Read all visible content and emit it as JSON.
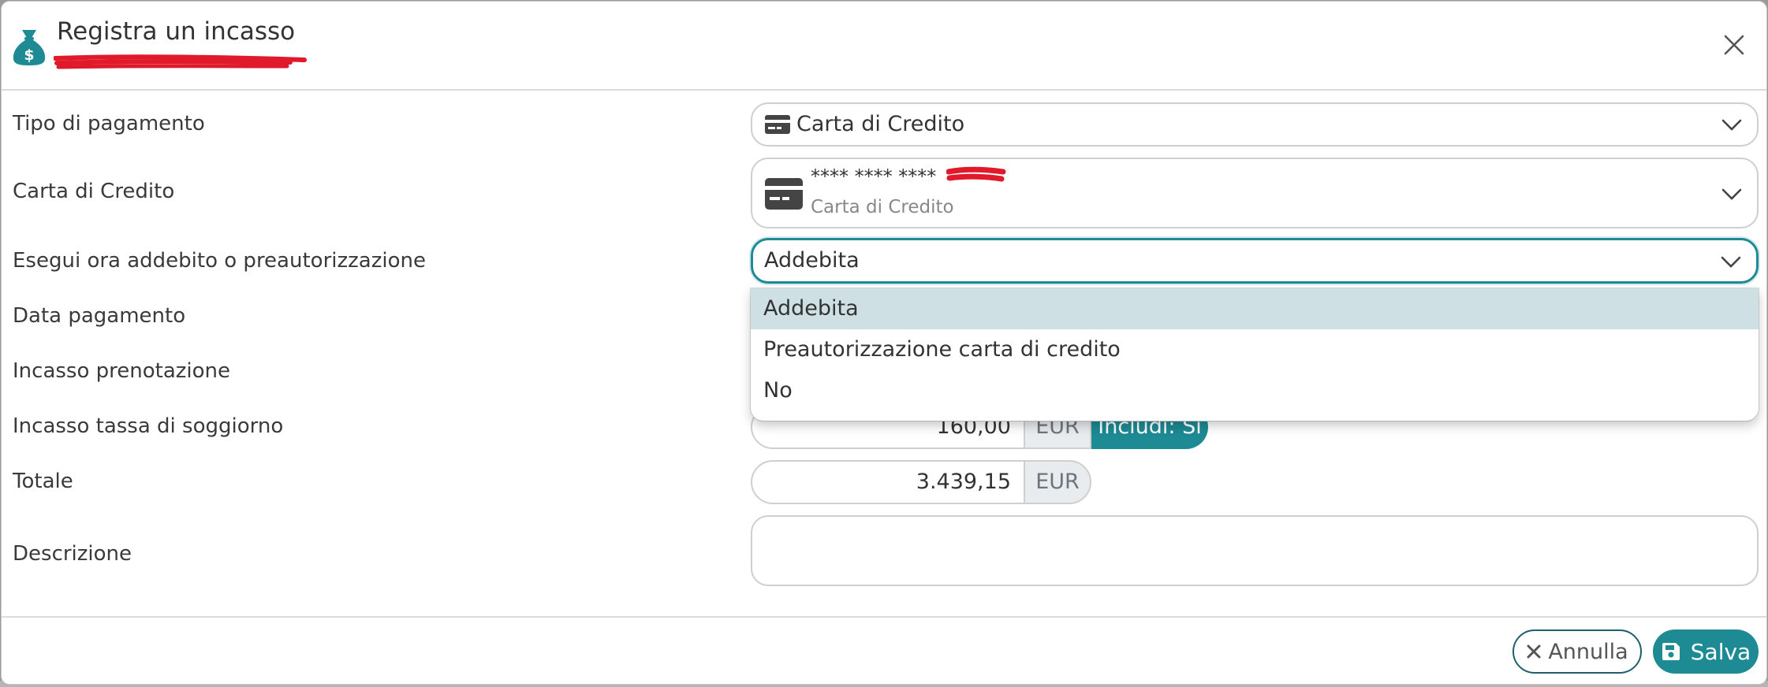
{
  "modal": {
    "title": "Registra un incasso",
    "close_icon": "close-icon",
    "header_icon": "money-bag-icon"
  },
  "form": {
    "tipo_pagamento": {
      "label": "Tipo di pagamento",
      "value": "Carta di Credito",
      "icon": "credit-card-icon"
    },
    "carta_di_credito": {
      "label": "Carta di Credito",
      "masked_number": "**** **** ****",
      "subtext": "Carta di Credito",
      "icon": "credit-card-icon"
    },
    "esegui": {
      "label": "Esegui ora addebito o preautorizzazione",
      "value": "Addebita",
      "options": [
        "Addebita",
        "Preautorizzazione carta di credito",
        "No"
      ],
      "selected_index": 0
    },
    "data_pagamento": {
      "label": "Data pagamento"
    },
    "incasso_prenotazione": {
      "label": "Incasso prenotazione"
    },
    "incasso_tassa": {
      "label": "Incasso tassa di soggiorno",
      "value": "160,00",
      "unit": "EUR",
      "include_label": "Includi: Si"
    },
    "totale": {
      "label": "Totale",
      "value": "3.439,15",
      "unit": "EUR"
    },
    "descrizione": {
      "label": "Descrizione",
      "value": ""
    }
  },
  "footer": {
    "cancel_label": "Annulla",
    "save_label": "Salva"
  },
  "colors": {
    "accent": "#1d8a94",
    "redaction": "#e0192b",
    "dropdown_active": "#cfe0e4"
  }
}
